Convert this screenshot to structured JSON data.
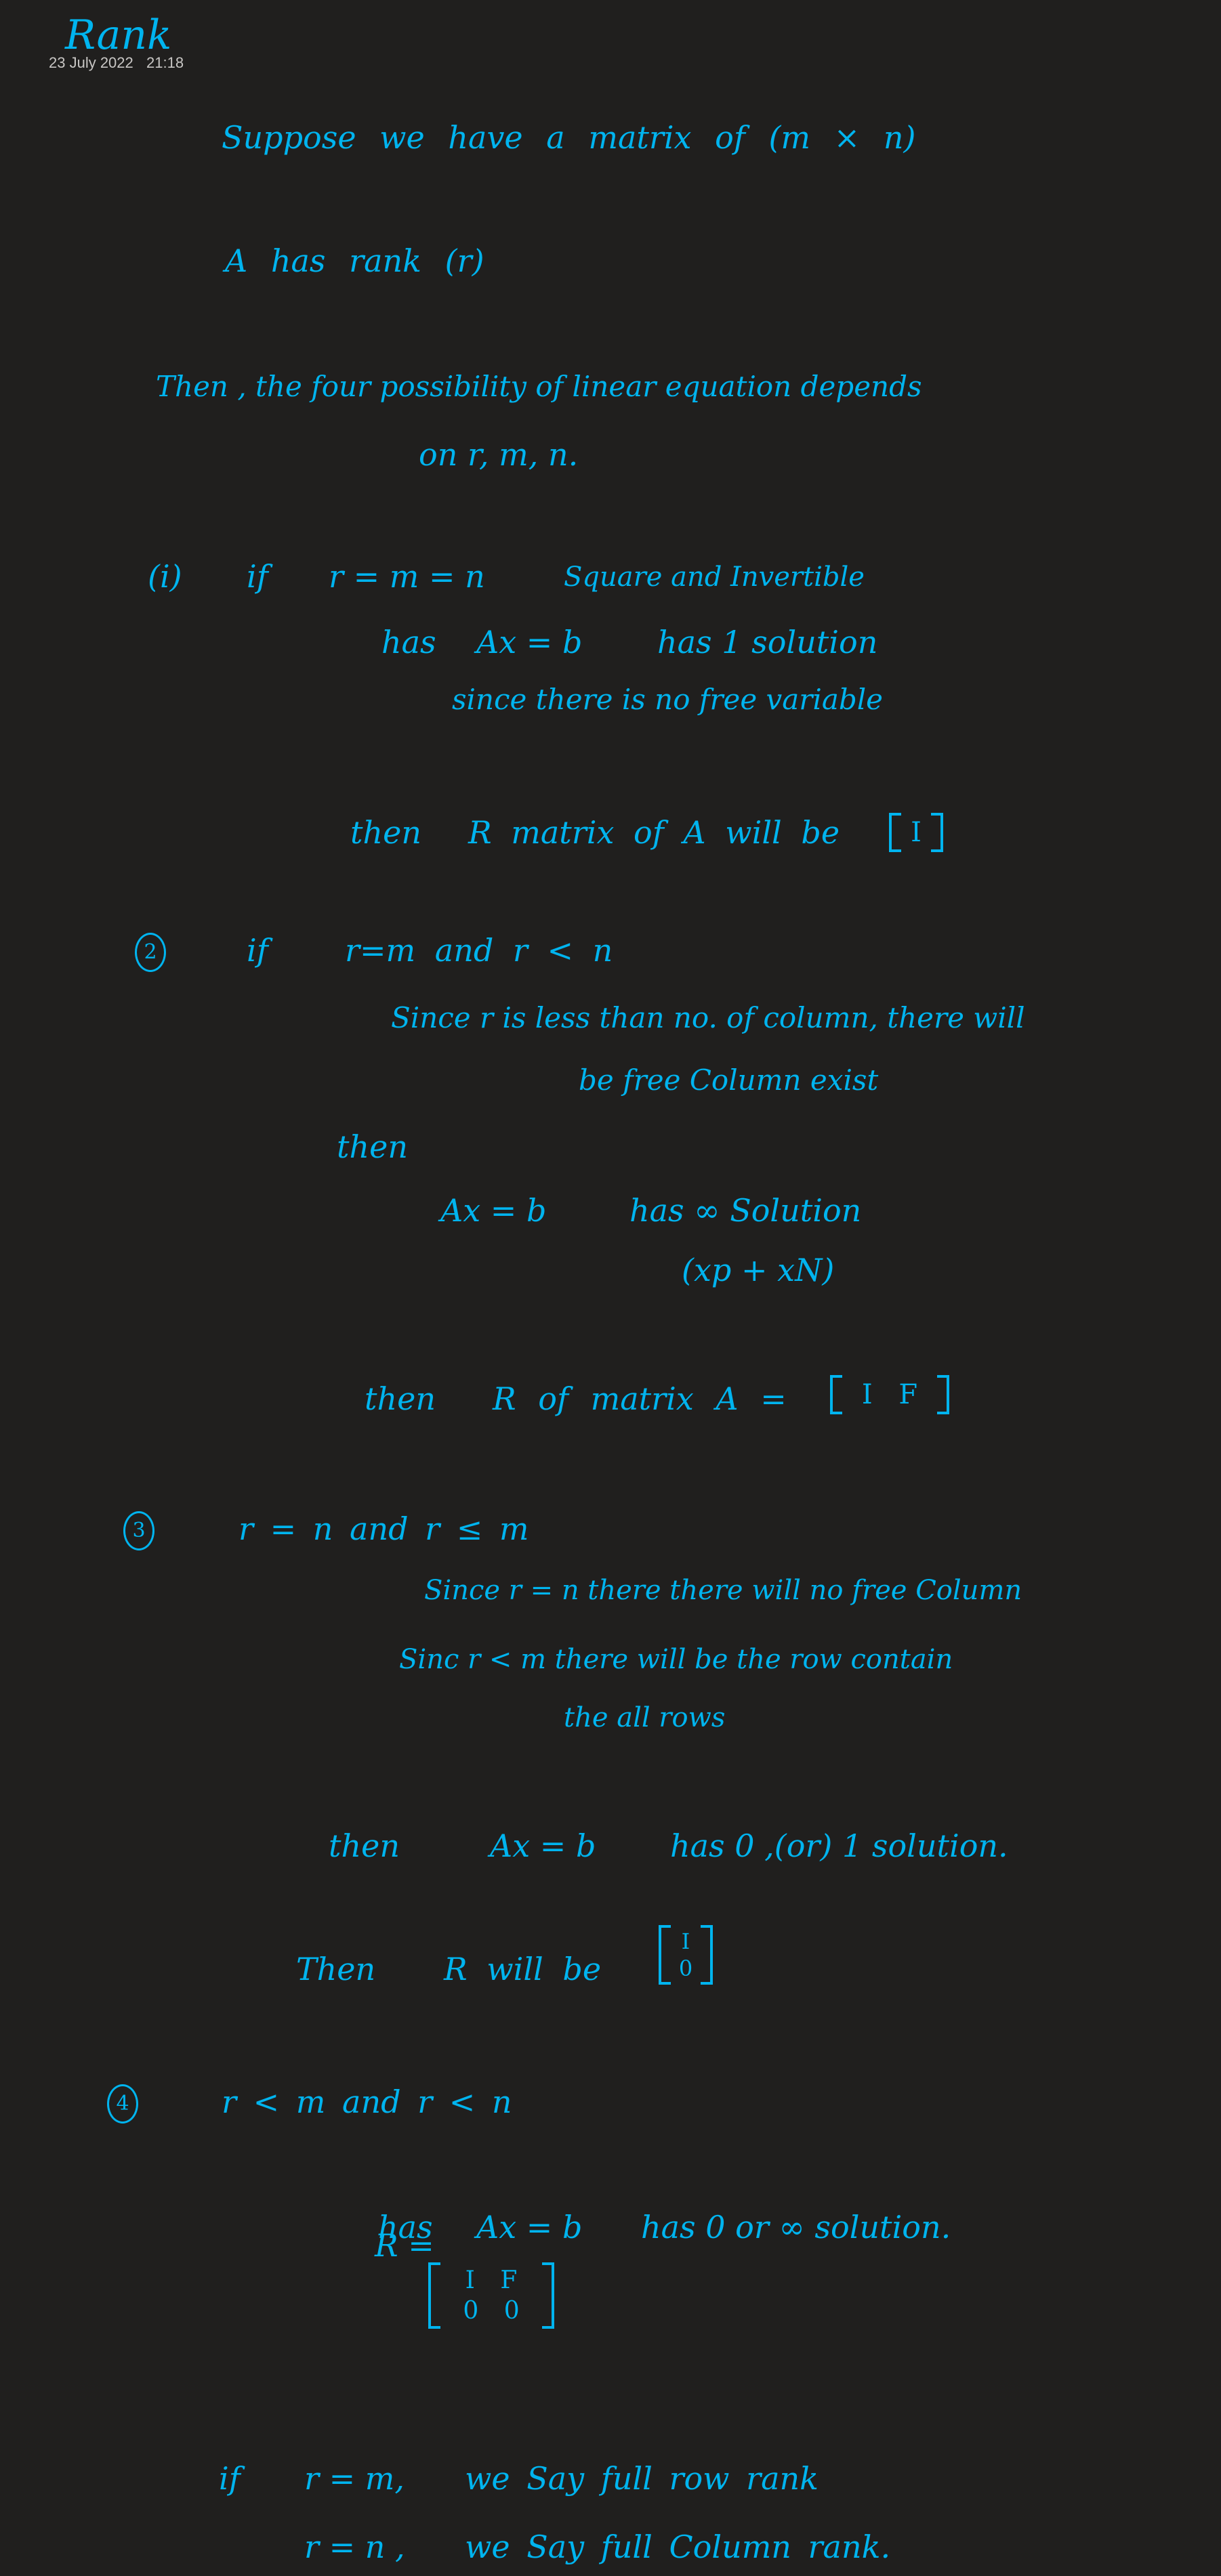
{
  "header": {
    "title": "Rank",
    "date": "23 July 2022",
    "time": "21:18"
  },
  "colors": {
    "background": "#201f1e",
    "ink": "#00b4ef"
  },
  "intro": {
    "line1": "Suppose  we  have  a  matrix  of  (m × n)",
    "line2": "A  has  rank  (r)",
    "line3": "Then ,  the  four  possibility  of  linear  equation  depends",
    "line4": "on   r, m, n."
  },
  "case1": {
    "marker": "(i)",
    "if": "if",
    "cond": "r = m = n",
    "desc": "Square and Invertible",
    "has": "has",
    "eq": "Ax = b",
    "result": "has   1 solution",
    "reason": "since  there  is  no  free  variable",
    "then": "then",
    "r_text": "R matrix   of   A   will  be",
    "matrix": [
      [
        "I"
      ]
    ]
  },
  "case2": {
    "marker": "2",
    "if": "if",
    "cond": "r=m   and r < n",
    "reason1": "Since  r  is  less than  no. of  column,  there  will",
    "reason2": "be  free  Column  exist",
    "then": "then",
    "eq": "Ax = b",
    "result": "has    ∞  Solution",
    "solution": "(xp + xN)",
    "then2": "then",
    "r_text": "R   of   matrix   A   =",
    "matrix": [
      [
        "I",
        "F"
      ]
    ]
  },
  "case3": {
    "marker": "3",
    "cond": "r = n    and    r ≤ m",
    "reason1": "Since   r = n   there  there  will  no  free  Column",
    "reason2": "Sinc   r < m   there   will   be    the  row  contain",
    "reason3": "the    all   rows",
    "then": "then",
    "eq": "Ax = b",
    "result": "has    0 ,(or)  1  solution.",
    "then2": "Then",
    "r_text": "R  will  be",
    "matrix": [
      [
        "I"
      ],
      [
        "0"
      ]
    ]
  },
  "case4": {
    "marker": "4",
    "cond": "r < m    and    r < n",
    "has": "has",
    "eq": "Ax = b",
    "result": "has     0  or  ∞  solution.",
    "r_label": "R =",
    "matrix": [
      [
        "I",
        "F"
      ],
      [
        "0",
        "0"
      ]
    ]
  },
  "summary": {
    "if": "if",
    "cond1": "r = m,",
    "text1": "we  Say  full  row  rank",
    "cond2": "r = n ,",
    "text2": "we  Say  full  Column  rank."
  }
}
